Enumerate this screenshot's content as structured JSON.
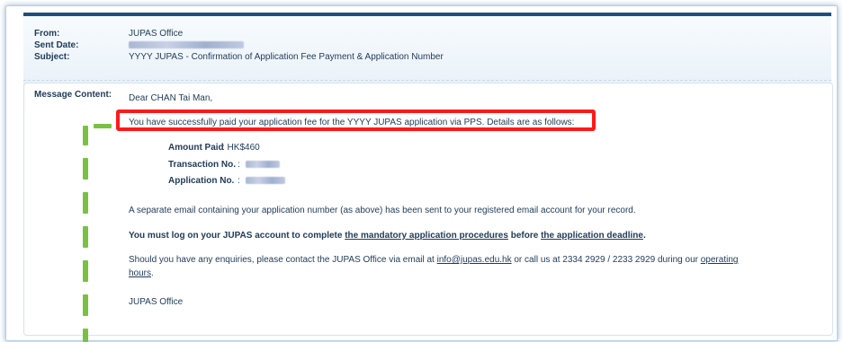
{
  "header": {
    "from_label": "From:",
    "from_value": "JUPAS Office",
    "sent_label": "Sent Date:",
    "subject_label": "Subject:",
    "subject_value": "YYYY JUPAS - Confirmation of Application Fee Payment & Application Number"
  },
  "message": {
    "label": "Message Content:",
    "greeting": "Dear CHAN Tai Man,",
    "highlight_text": "You have successfully paid your application fee for the YYYY JUPAS application via PPS. Details are as follows:",
    "details": {
      "amount_label": "Amount Paid",
      "amount_value": ": HK$460",
      "txn_label": "Transaction No.",
      "txn_sep": ":",
      "app_label": "Application No.",
      "app_sep": ":"
    },
    "p1": "A separate email containing your application number (as above) has been sent to your registered email account for your record.",
    "p2_a": "You must log on your JUPAS account to complete ",
    "p2_link1": "the mandatory application procedures",
    "p2_b": " before ",
    "p2_link2": "the application deadline",
    "p2_c": ".",
    "p3_a": "Should you have any enquiries, please contact the JUPAS Office via email at ",
    "p3_email": "info@jupas.edu.hk",
    "p3_b": " or call us at 2334 2929 / 2233 2929 during our ",
    "p3_link": "operating",
    "p3_link2": "hours",
    "p3_c": ".",
    "signoff": "JUPAS Office"
  },
  "colors": {
    "highlight_border": "#ff1a1a",
    "guide_dash": "#7ac143",
    "header_bar": "#1e4f7d"
  }
}
